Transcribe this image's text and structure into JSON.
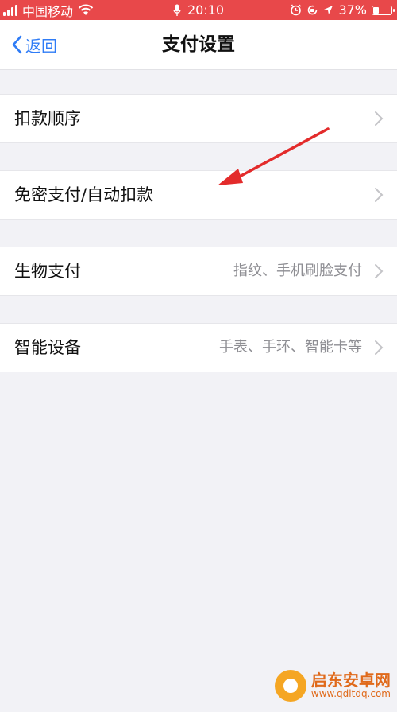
{
  "status_bar": {
    "carrier": "中国移动",
    "time": "20:10",
    "battery": "37%",
    "battery_level": 0.37,
    "icons": [
      "signal-icon",
      "wifi-icon",
      "microphone-icon",
      "alarm-icon",
      "rotation-lock-icon",
      "location-icon",
      "battery-icon"
    ]
  },
  "nav": {
    "back_label": "返回",
    "title": "支付设置"
  },
  "cells": [
    {
      "title": "扣款顺序",
      "detail": ""
    },
    {
      "title": "免密支付/自动扣款",
      "detail": ""
    },
    {
      "title": "生物支付",
      "detail": "指纹、手机刷脸支付"
    },
    {
      "title": "智能设备",
      "detail": "手表、手环、智能卡等"
    }
  ],
  "annotation": {
    "color": "#e32b2b"
  },
  "watermark": {
    "name": "启东安卓网",
    "url": "www.qdltdq.com"
  },
  "colors": {
    "status_bar": "#e8484a",
    "accent": "#2f7cf6",
    "background": "#f2f2f6"
  }
}
